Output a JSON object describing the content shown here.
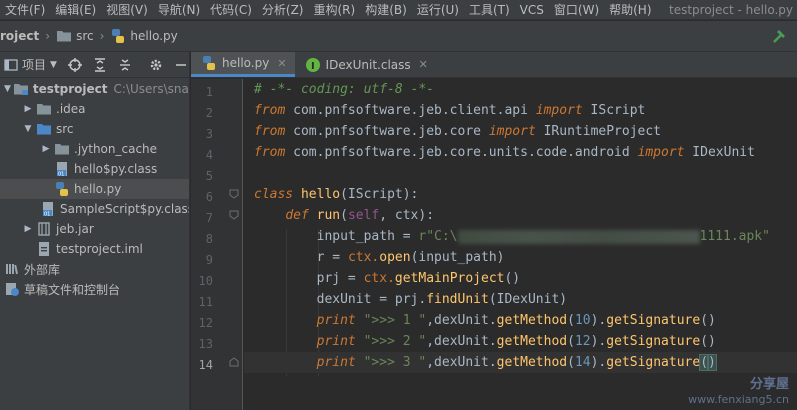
{
  "menu": {
    "items": [
      "文件(F)",
      "编辑(E)",
      "视图(V)",
      "导航(N)",
      "代码(C)",
      "分析(Z)",
      "重构(R)",
      "构建(B)",
      "运行(U)",
      "工具(T)",
      "VCS",
      "窗口(W)",
      "帮助(H)"
    ],
    "window_title": "testproject - hello.py"
  },
  "breadcrumb": {
    "project": "roject",
    "folder": "src",
    "file": "hello.py"
  },
  "project_pane": {
    "title": "项目",
    "tree": [
      {
        "label": "testproject",
        "sub": "C:\\Users\\snake\\"
      },
      {
        "label": ".idea"
      },
      {
        "label": "src"
      },
      {
        "label": ".jython_cache"
      },
      {
        "label": "hello$py.class"
      },
      {
        "label": "hello.py"
      },
      {
        "label": "SampleScript$py.class"
      },
      {
        "label": "jeb.jar"
      },
      {
        "label": "testproject.iml"
      },
      {
        "label": "外部库"
      },
      {
        "label": "草稿文件和控制台"
      }
    ]
  },
  "tabs": [
    {
      "label": "hello.py"
    },
    {
      "label": "IDexUnit.class"
    }
  ],
  "code": {
    "line_numbers": [
      "1",
      "2",
      "3",
      "4",
      "5",
      "6",
      "7",
      "8",
      "9",
      "10",
      "11",
      "12",
      "13",
      "14"
    ],
    "l1_comment": "# -*- coding: utf-8 -*-",
    "kw_from": "from",
    "kw_import": "import",
    "kw_class": "class",
    "kw_def": "def",
    "kw_print": "print",
    "l2_mod": " com.pnfsoftware.jeb.client.api ",
    "l2_name": " IScript",
    "l3_mod": " com.pnfsoftware.jeb.core ",
    "l3_name": " IRuntimeProject",
    "l4_mod": " com.pnfsoftware.jeb.core.units.code.android ",
    "l4_name": " IDexUnit",
    "l6_name": "hello",
    "l6_rest": "(IScript):",
    "l7_name": "run",
    "l7_open": "(",
    "l7_self": "self",
    "l7_rest": ", ctx):",
    "l8_var": "input_path = ",
    "l8_str_start": "r\"C:\\",
    "l8_str_end": "1111.apk\"",
    "l9_a": "r = ",
    "l9_ctx": "ctx.",
    "l9_fn": "open",
    "l9_b": "(input_path)",
    "l10_a": "prj = ",
    "l10_ctx": "ctx.",
    "l10_fn": "getMainProject",
    "l10_b": "()",
    "l11_a": "dexUnit = prj.",
    "l11_fn": "findUnit",
    "l11_b": "(IDexUnit)",
    "l12_str": " \">>> 1 \"",
    "l13_str": " \">>> 2 \"",
    "l14_str": " \">>> 3 \"",
    "p_mid": ",dexUnit.",
    "p_fn": "getMethod",
    "p_open": "(",
    "n12": "10",
    "n13": "12",
    "n14": "14",
    "p_close": ").",
    "p_sig": "getSignature",
    "p_end": "()",
    "p_end_a": "(",
    "p_end_b": ")"
  },
  "watermark": {
    "line1": "分享屋",
    "line2": "www.fenxiang5.cn"
  }
}
